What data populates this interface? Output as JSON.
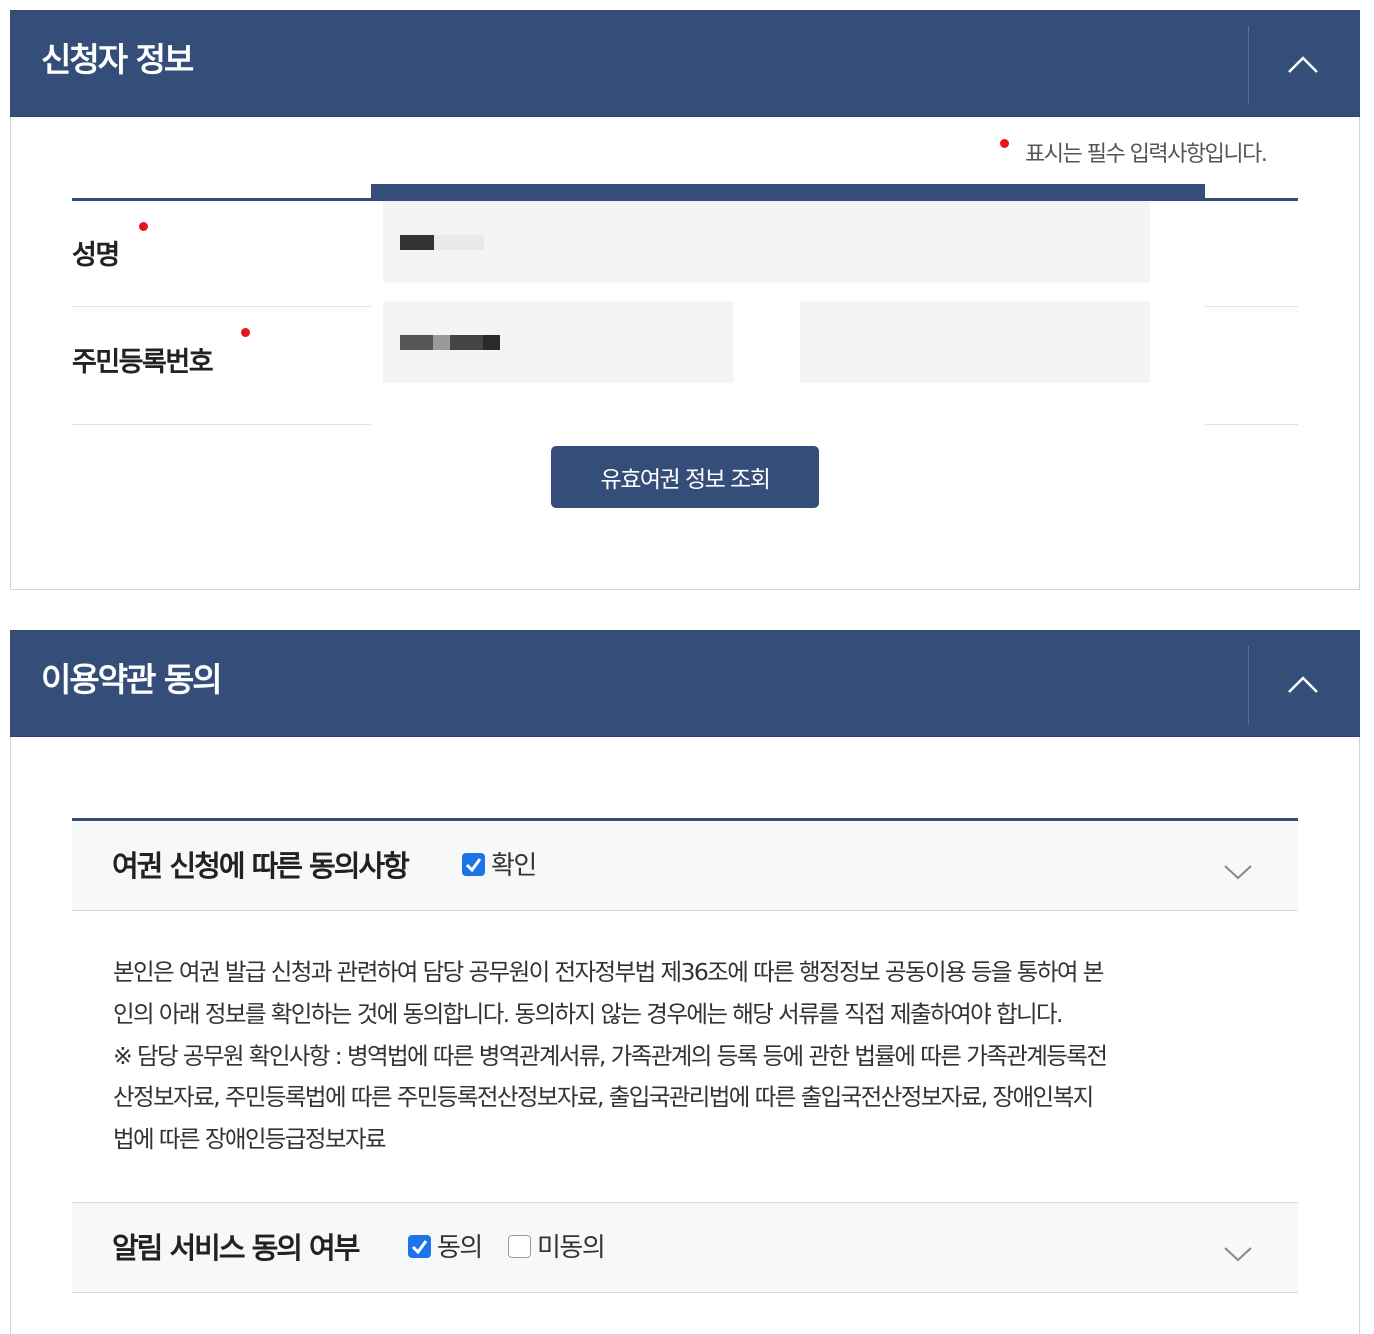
{
  "applicant_section": {
    "title": "신청자 정보",
    "required_note": "표시는 필수 입력사항입니다.",
    "name_label": "성명",
    "rrn_label": "주민등록번호",
    "lookup_button": "유효여권 정보 조회"
  },
  "terms_section": {
    "title": "이용약관 동의",
    "passport_consent": {
      "title": "여권 신청에 따른 동의사항",
      "confirm_label": "확인",
      "confirm_checked": true,
      "text_lines": [
        "본인은 여권 발급 신청과 관련하여 담당 공무원이 전자정부법 제36조에 따른 행정정보 공동이용 등을 통하여 본",
        "인의 아래 정보를 확인하는 것에 동의합니다. 동의하지 않는 경우에는 해당 서류를 직접 제출하여야 합니다.",
        "※ 담당 공무원 확인사항 : 병역법에 따른 병역관계서류, 가족관계의 등록 등에 관한 법률에 따른 가족관계등록전",
        "산정보자료, 주민등록법에 따른 주민등록전산정보자료, 출입국관리법에 따른 출입국전산정보자료, 장애인복지",
        "법에 따른 장애인등급정보자료"
      ]
    },
    "notification_consent": {
      "title": "알림 서비스 동의 여부",
      "agree_label": "동의",
      "agree_checked": true,
      "disagree_label": "미동의",
      "disagree_checked": false
    }
  },
  "colors": {
    "header_bg": "#344d79",
    "button_bg": "#344d79",
    "required_dot": "#e8141b",
    "checkbox_on": "#1b74e8"
  }
}
